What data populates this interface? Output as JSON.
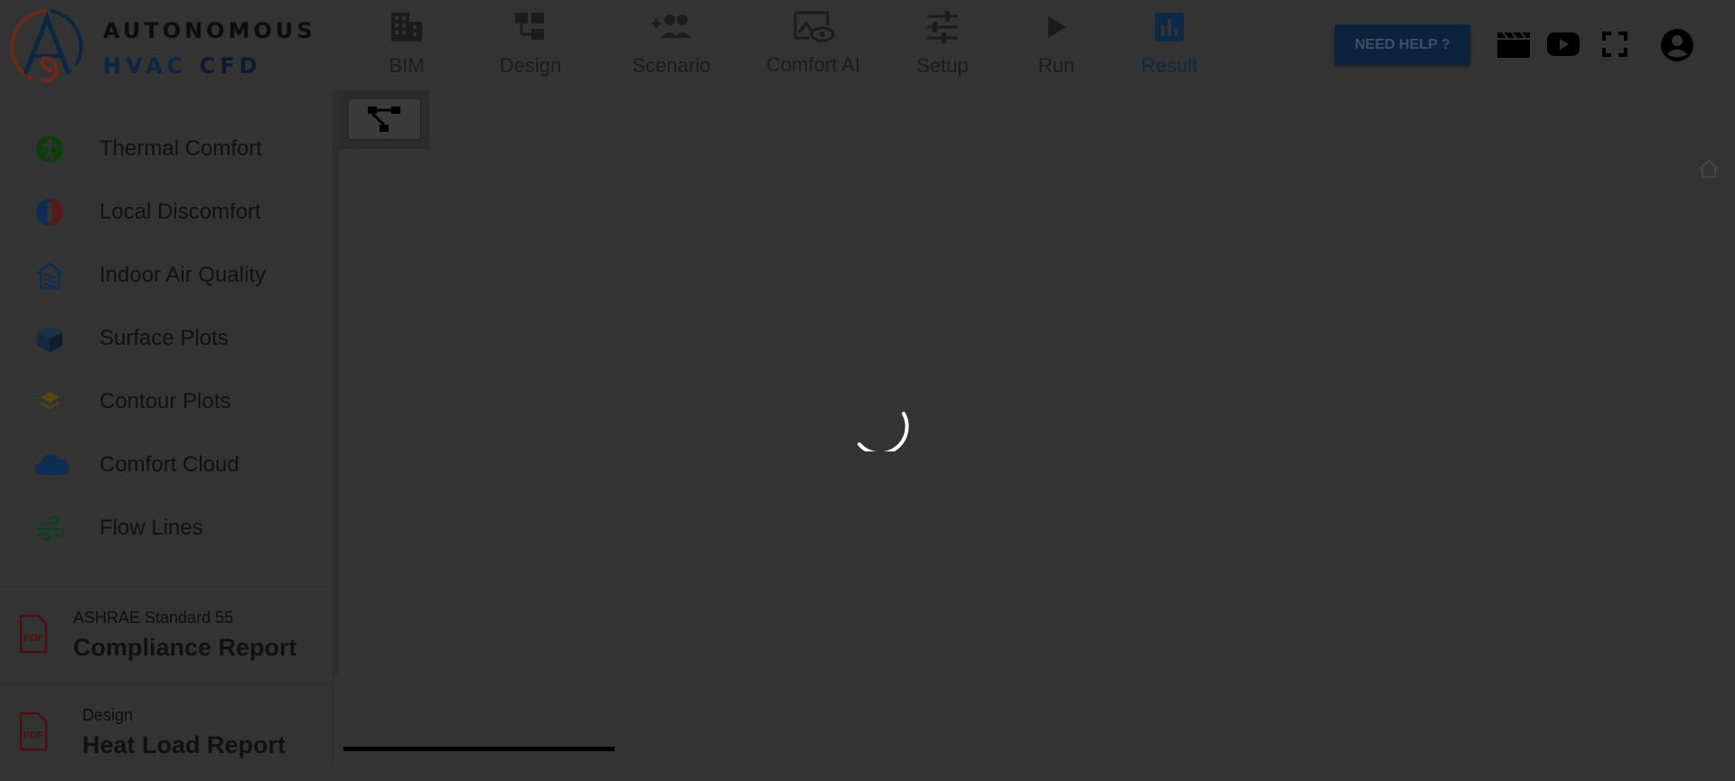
{
  "brand": {
    "line1": "AUTONOMOUS",
    "line2_part1": "HVAC",
    "line2_part2": " CFD",
    "colors": {
      "ring_red": "#6a2a1a",
      "ring_blue": "#0b2744"
    }
  },
  "nav": {
    "items": [
      {
        "label": "BIM",
        "icon": "building-icon"
      },
      {
        "label": "Design",
        "icon": "design-icon"
      },
      {
        "label": "Scenario",
        "icon": "add-people-icon"
      },
      {
        "label": "Comfort AI",
        "icon": "eye-image-icon"
      },
      {
        "label": "Setup",
        "icon": "sliders-icon"
      },
      {
        "label": "Run",
        "icon": "play-icon"
      },
      {
        "label": "Result",
        "icon": "bar-chart-icon",
        "active": true
      }
    ],
    "active_color": "#0d2948"
  },
  "header": {
    "help_label": "NEED HELP ?",
    "icons": [
      "clapperboard-icon",
      "youtube-icon",
      "fullscreen-icon",
      "account-icon"
    ]
  },
  "sidebar": {
    "items": [
      {
        "label": "Thermal Comfort",
        "icon": "accessibility-icon",
        "color": "#0f3d0f"
      },
      {
        "label": "Local Discomfort",
        "icon": "person-gauge-icon",
        "color": "#0d2d52"
      },
      {
        "label": "Indoor Air Quality",
        "icon": "air-house-icon",
        "color": "#0d2d52"
      },
      {
        "label": "Surface Plots",
        "icon": "cube-icon",
        "color": "#162a3d"
      },
      {
        "label": "Contour Plots",
        "icon": "layers-icon",
        "color": "#5a4a10"
      },
      {
        "label": "Comfort Cloud",
        "icon": "cloud-icon",
        "color": "#0d2d52"
      },
      {
        "label": "Flow Lines",
        "icon": "wind-icon",
        "color": "#0f3d1f"
      }
    ],
    "reports": [
      {
        "subtitle": "ASHRAE Standard 55",
        "title": "Compliance Report",
        "icon": "pdf-icon"
      },
      {
        "subtitle": "Design",
        "title": "Heat Load Report",
        "icon": "pdf-icon"
      }
    ]
  },
  "main": {
    "toolbar_icon": "tree-structure-icon",
    "corner_icon": "home-icon",
    "loading": true
  }
}
